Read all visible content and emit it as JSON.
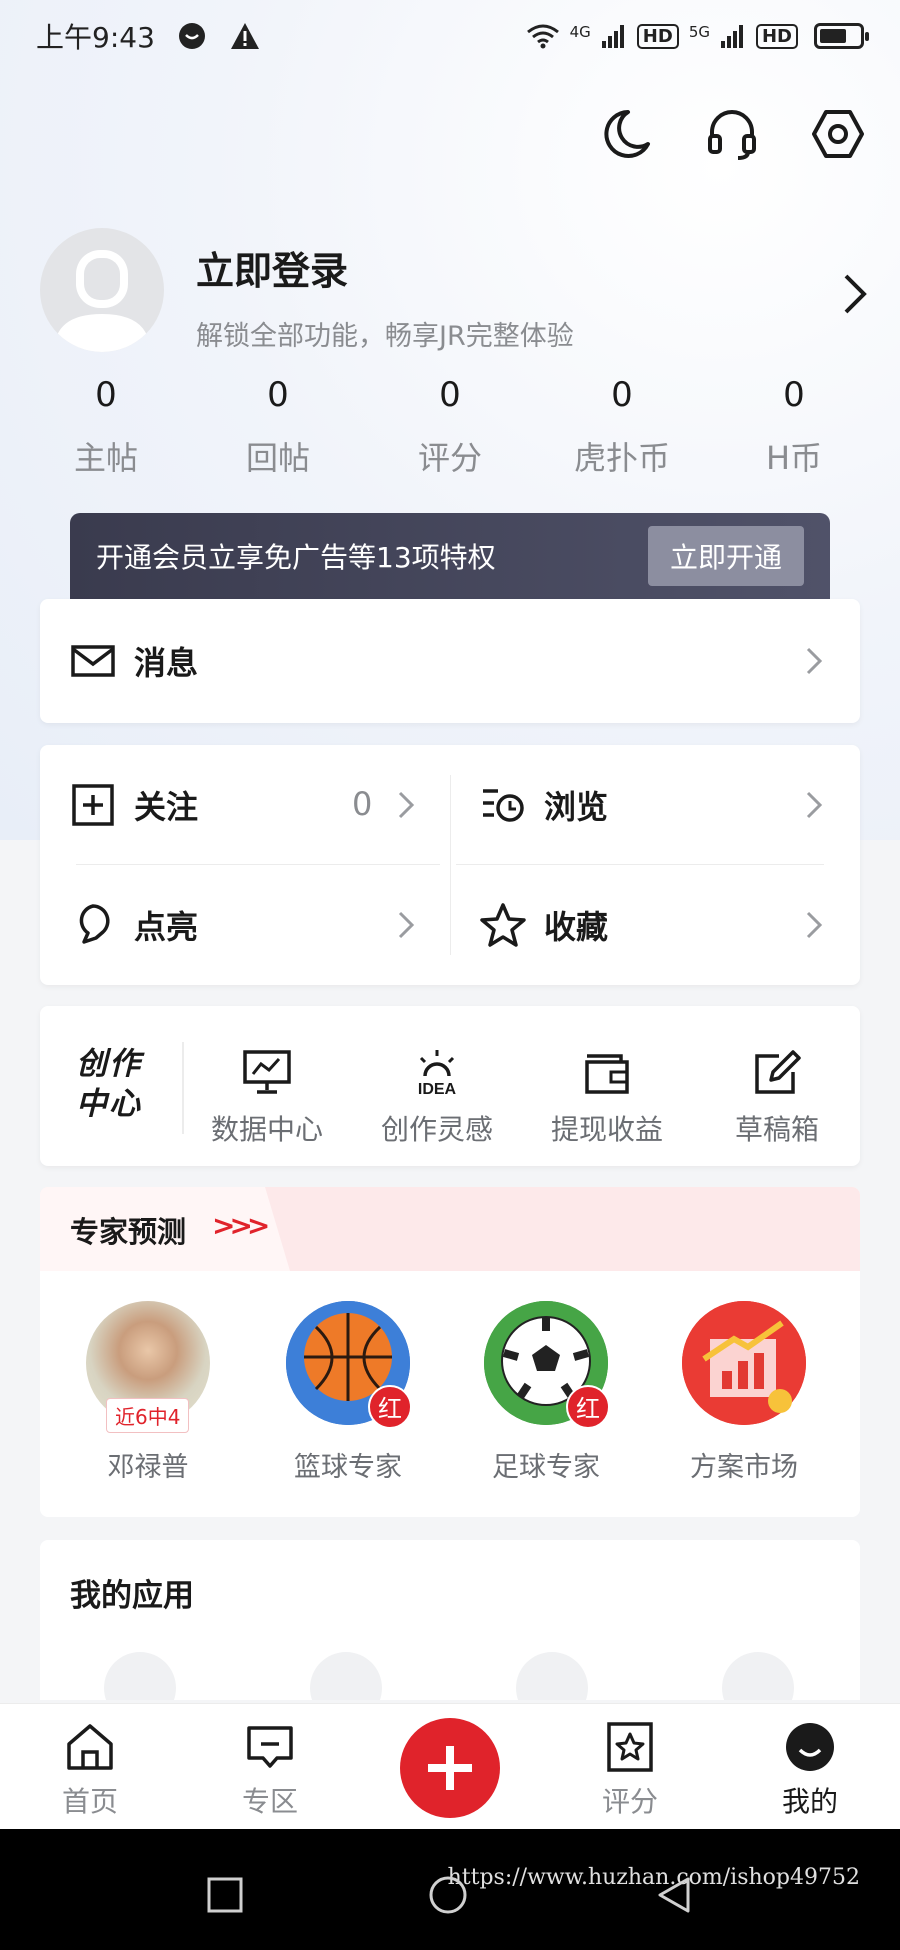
{
  "status_bar": {
    "time": "上午9:43",
    "network1": "4G",
    "network2": "5G",
    "hd": "HD"
  },
  "header_icons": [
    "moon-icon",
    "headset-icon",
    "settings-hex-icon"
  ],
  "profile": {
    "title": "立即登录",
    "subtitle": "解锁全部功能，畅享JR完整体验"
  },
  "stats": [
    {
      "value": "0",
      "label": "主帖"
    },
    {
      "value": "0",
      "label": "回帖"
    },
    {
      "value": "0",
      "label": "评分"
    },
    {
      "value": "0",
      "label": "虎扑币"
    },
    {
      "value": "0",
      "label": "H币"
    }
  ],
  "vip": {
    "text": "开通会员立享免广告等13项特权",
    "button": "立即开通"
  },
  "messages": {
    "label": "消息"
  },
  "grid": {
    "follow": {
      "label": "关注",
      "count": "0"
    },
    "browse": {
      "label": "浏览"
    },
    "light": {
      "label": "点亮"
    },
    "favorite": {
      "label": "收藏"
    }
  },
  "creator": {
    "title_line1": "创作",
    "title_line2": "中心",
    "tools": [
      {
        "label": "数据中心",
        "icon": "chart-board-icon"
      },
      {
        "label": "创作灵感",
        "icon": "idea-bulb-icon",
        "icon_text": "IDEA"
      },
      {
        "label": "提现收益",
        "icon": "wallet-icon"
      },
      {
        "label": "草稿箱",
        "icon": "edit-icon"
      }
    ]
  },
  "experts": {
    "title": "专家预测",
    "items": [
      {
        "name": "邓禄普",
        "tag": "近6中4"
      },
      {
        "name": "篮球专家",
        "badge": "红"
      },
      {
        "name": "足球专家",
        "badge": "红"
      },
      {
        "name": "方案市场"
      }
    ]
  },
  "apps": {
    "title": "我的应用"
  },
  "tabbar": [
    {
      "label": "首页",
      "icon": "home-icon"
    },
    {
      "label": "专区",
      "icon": "zone-icon"
    },
    {
      "label": "评分",
      "icon": "rating-icon"
    },
    {
      "label": "我的",
      "icon": "profile-face-icon"
    }
  ],
  "watermark": "https://www.huzhan.com/ishop49752",
  "colors": {
    "accent": "#e0232b",
    "vip_bg": "#3a3b4e",
    "muted": "#8a8c90"
  }
}
